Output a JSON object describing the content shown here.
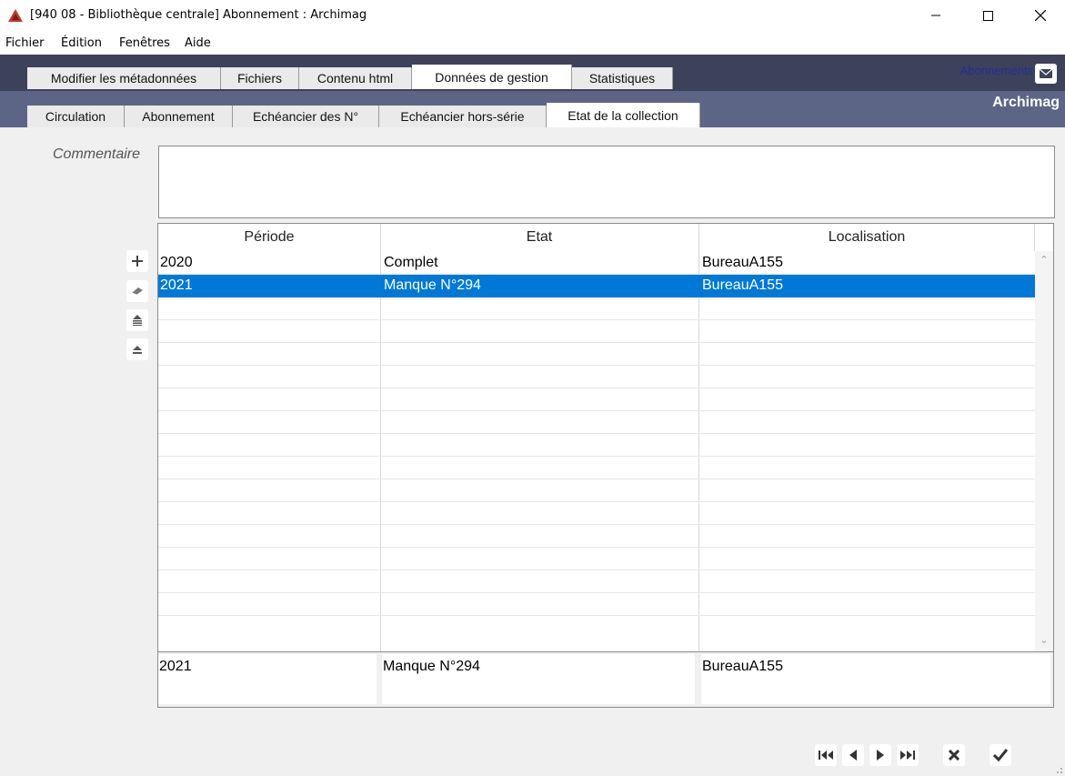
{
  "window": {
    "title": "[940 08 - Bibliothèque centrale] Abonnement : Archimag",
    "controls": [
      "minimize",
      "maximize",
      "close"
    ]
  },
  "menu": [
    "Fichier",
    "Édition",
    "Fenêtres",
    "Aide"
  ],
  "top_tabs": [
    {
      "label": "Modifier les métadonnées",
      "active": false
    },
    {
      "label": "Fichiers",
      "active": false
    },
    {
      "label": "Contenu html",
      "active": false
    },
    {
      "label": "Données de gestion",
      "active": true
    },
    {
      "label": "Statistiques",
      "active": false
    }
  ],
  "sub_tabs": [
    {
      "label": "Circulation",
      "active": false
    },
    {
      "label": "Abonnement",
      "active": false
    },
    {
      "label": "Echéancier des N°",
      "active": false
    },
    {
      "label": "Echéancier hors-série",
      "active": false
    },
    {
      "label": "Etat de la collection",
      "active": true
    }
  ],
  "header_link": "Abonnements",
  "header_context": "Archimag",
  "comment": {
    "label": "Commentaire",
    "value": ""
  },
  "table": {
    "columns": [
      "Période",
      "Etat",
      "Localisation"
    ],
    "rows": [
      {
        "periode": "2020",
        "etat": "Complet",
        "localisation": "BureauA155",
        "selected": false
      },
      {
        "periode": "2021",
        "etat": "Manque N°294",
        "localisation": "BureauA155",
        "selected": true
      }
    ]
  },
  "detail": {
    "periode": "2021",
    "etat": "Manque N°294",
    "localisation": "BureauA155"
  },
  "side_buttons": [
    "add-icon",
    "eraser-icon",
    "move-up-icon",
    "move-top-icon"
  ],
  "nav_buttons": [
    "first-record-icon",
    "previous-record-icon",
    "next-record-icon",
    "last-record-icon"
  ],
  "action_buttons": [
    "cancel-icon",
    "validate-icon"
  ],
  "colors": {
    "dark_band": "#3c4259",
    "sub_band": "#5d6586",
    "selection": "#0078d7"
  }
}
